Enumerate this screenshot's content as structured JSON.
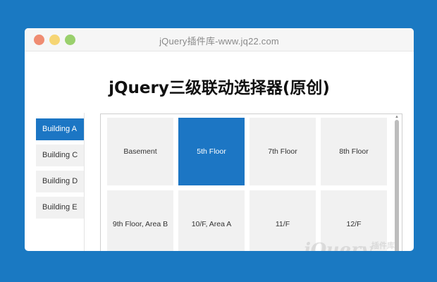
{
  "window": {
    "title": "jQuery插件库-www.jq22.com"
  },
  "page": {
    "heading": "jQuery三级联动选择器(原创)"
  },
  "buildings": [
    {
      "label": "Building A",
      "active": true
    },
    {
      "label": "Building C",
      "active": false
    },
    {
      "label": "Building D",
      "active": false
    },
    {
      "label": "Building E",
      "active": false
    }
  ],
  "floors": [
    {
      "label": "Basement",
      "active": false
    },
    {
      "label": "5th Floor",
      "active": true
    },
    {
      "label": "7th Floor",
      "active": false
    },
    {
      "label": "8th Floor",
      "active": false
    },
    {
      "label": "9th Floor, Area B",
      "active": false
    },
    {
      "label": "10/F, Area A",
      "active": false
    },
    {
      "label": "11/F",
      "active": false
    },
    {
      "label": "12/F",
      "active": false
    }
  ],
  "watermark": {
    "text": "jQuery",
    "sub": "插件库"
  },
  "colors": {
    "background": "#1a79c2",
    "accent": "#1c76c4"
  }
}
